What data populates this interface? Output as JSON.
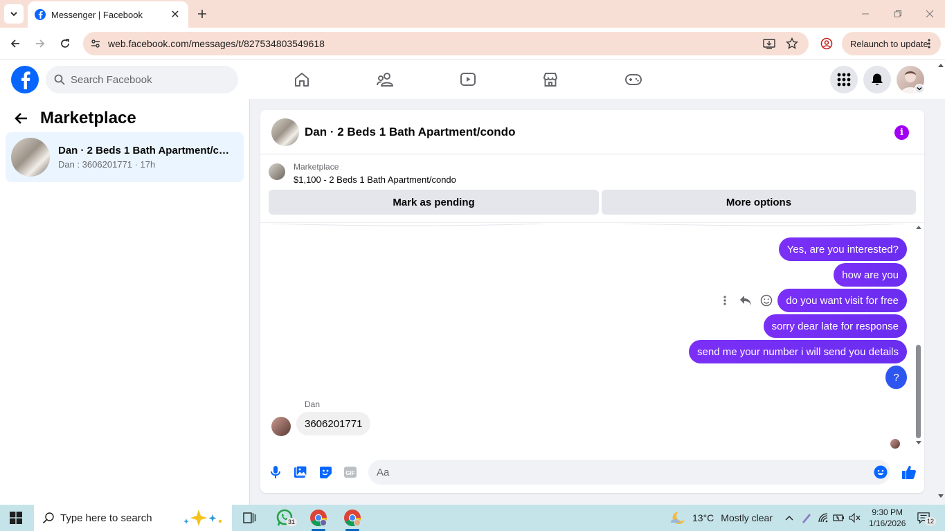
{
  "browser": {
    "tab_title": "Messenger | Facebook",
    "url": "web.facebook.com/messages/t/827534803549618",
    "relaunch_label": "Relaunch to update"
  },
  "fb_header": {
    "search_placeholder": "Search Facebook"
  },
  "sidebar": {
    "title": "Marketplace",
    "conversations": [
      {
        "name": "Dan · 2 Beds 1 Bath Apartment/co...",
        "preview": "Dan : 3606201771 · 17h"
      }
    ]
  },
  "chat": {
    "title": "Dan · 2 Beds 1 Bath Apartment/condo",
    "marketplace_label": "Marketplace",
    "listing": "$1,100 - 2 Beds 1 Bath Apartment/condo",
    "mark_pending_label": "Mark as pending",
    "more_options_label": "More options",
    "outgoing_messages": [
      "Yes, are you interested?",
      "how are you",
      "do you want visit for free",
      "sorry dear late for response",
      "send me your number i will send you details",
      "?"
    ],
    "incoming_sender": "Dan",
    "incoming_message": "3606201771",
    "composer_placeholder": "Aa"
  },
  "taskbar": {
    "search_placeholder": "Type here to search",
    "whatsapp_badge": "31",
    "temperature": "13°C",
    "weather": "Mostly clear",
    "time": "9:30 PM",
    "date": "1/16/2026",
    "notification_count": "12"
  },
  "colors": {
    "fb_blue": "#0866ff",
    "bubble_purple": "#7b2ff7",
    "info_purple": "#a100f2",
    "chrome_tint": "#f8dfd6",
    "taskbar": "#c5e4ea"
  }
}
